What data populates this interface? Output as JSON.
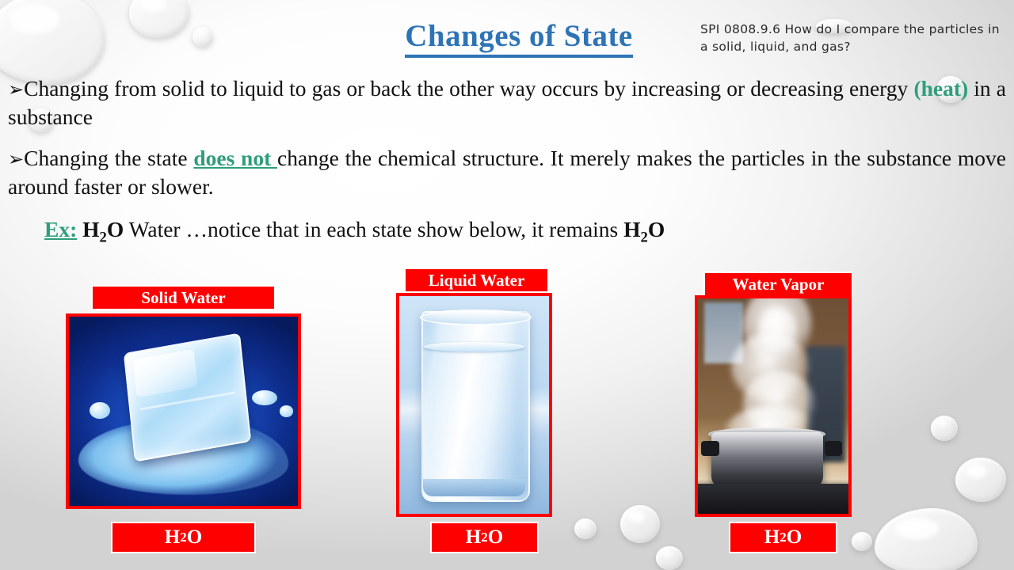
{
  "slide": {
    "title": "Changes of State",
    "standard_note": "SPI 0808.9.6  How do I compare the particles in a solid, liquid, and gas?",
    "bullets": [
      {
        "marker": "➢",
        "part1": "Changing from solid to liquid to gas or back the other way occurs by increasing or decreasing energy ",
        "highlight": "(heat)",
        "part2": " in a substance"
      },
      {
        "marker": "➢",
        "part1": "Changing the state ",
        "highlight": "does not ",
        "part2": "change the chemical structure. It merely makes the particles in the substance move around faster or slower."
      }
    ],
    "example": {
      "label": "Ex:",
      "formula_pre": "H",
      "formula_sub": "2",
      "formula_post": "O",
      "text": " Water …notice that in each state show below, it remains ",
      "end_pre": "H",
      "end_sub": "2",
      "end_post": "O"
    },
    "colors": {
      "title": "#2E74B5",
      "highlight_green": "#2E9E7B",
      "chip_red": "#FF0000",
      "chip_text": "#FFFFFF",
      "body_text": "#111111"
    },
    "states": [
      {
        "caption": "Solid Water",
        "formula_pre": "H",
        "formula_sub": "2",
        "formula_post": "O",
        "image_name": "melting-ice-cube-photo"
      },
      {
        "caption": "Liquid Water",
        "formula_pre": "H",
        "formula_sub": "2",
        "formula_post": "O",
        "image_name": "glass-of-water-photo"
      },
      {
        "caption": "Water Vapor",
        "formula_pre": "H",
        "formula_sub": "2",
        "formula_post": "O",
        "image_name": "steaming-pot-photo"
      }
    ]
  }
}
